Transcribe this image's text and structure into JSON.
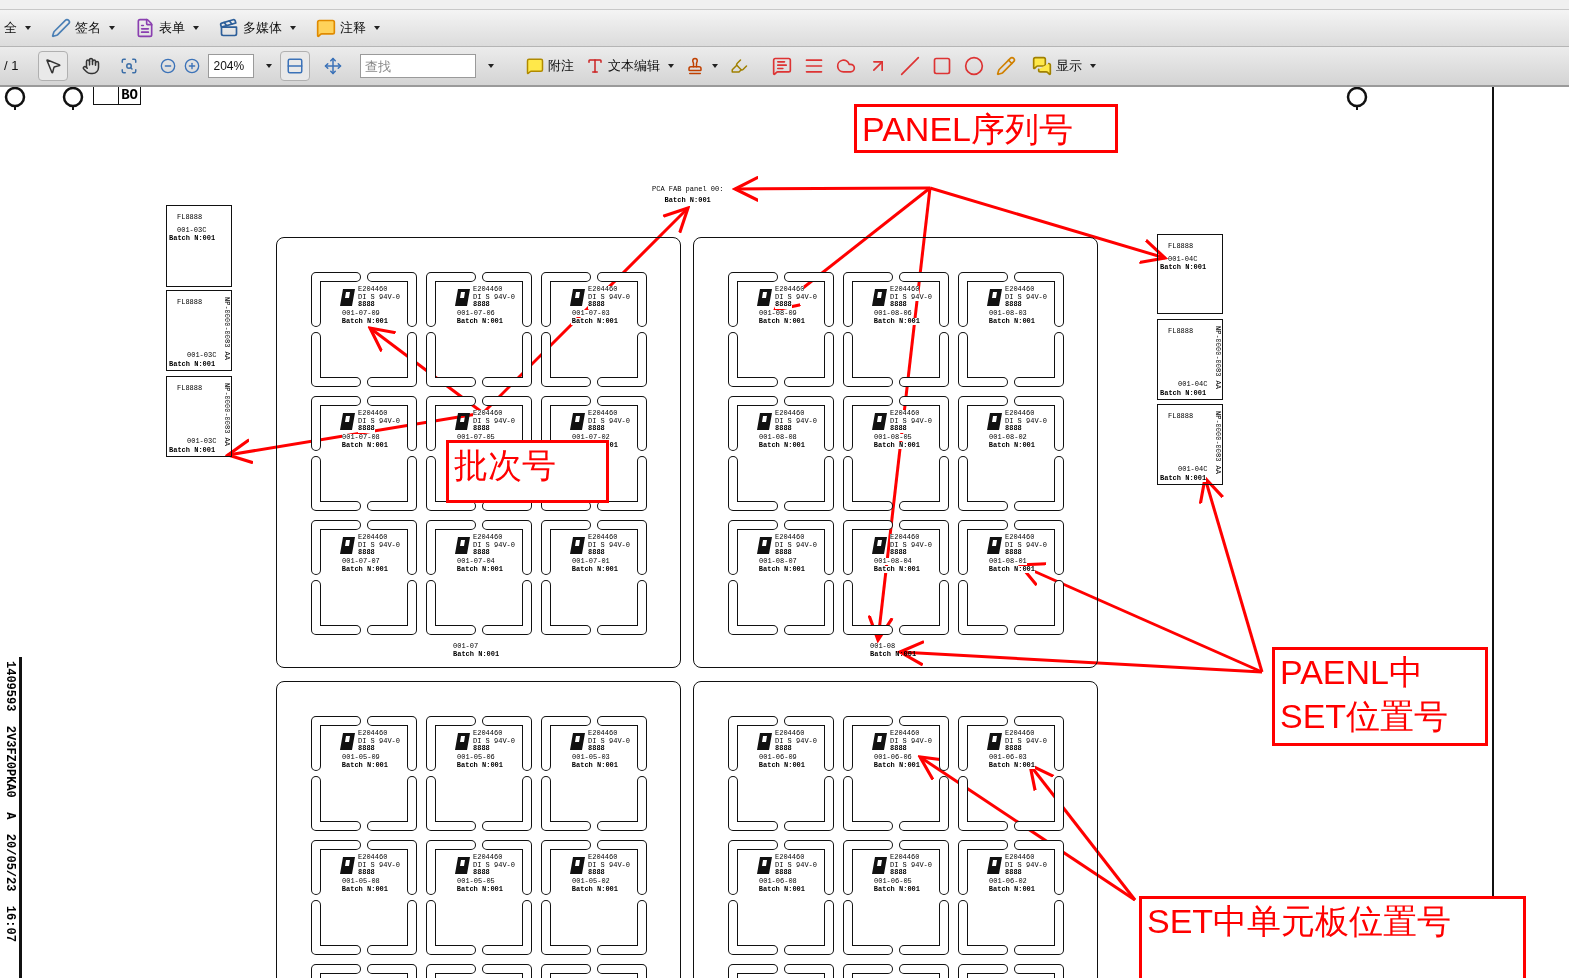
{
  "toolbar_top": {
    "items": [
      {
        "label": "全",
        "dropdown": true
      },
      {
        "label": "签名",
        "dropdown": true
      },
      {
        "label": "表单",
        "dropdown": true
      },
      {
        "label": "多媒体",
        "dropdown": true
      },
      {
        "label": "注释",
        "dropdown": true
      }
    ]
  },
  "toolbar_nav": {
    "page_count": "/ 1",
    "tools": [
      {
        "selected": true
      },
      {
        "selected": false
      },
      {
        "selected": false
      }
    ],
    "zoom_value": "204%",
    "view_modes": [
      {
        "selected": true
      },
      {
        "selected": false
      }
    ],
    "search": {
      "placeholder": "查找"
    },
    "comment_tools": [
      {
        "label": "附注",
        "dropdown": false
      },
      {
        "label": "文本编辑",
        "dropdown": true
      },
      {
        "dropdown": true
      },
      {
        "dropdown": false
      }
    ],
    "show": {
      "label": "显示",
      "dropdown": true
    }
  },
  "drawing": {
    "header_box": "BO",
    "side_stamp": "1409593  2V3FZ0PKA0  A  20/05/23  16:07",
    "panel_title": {
      "text": "PCA FAB panel 00:",
      "batch": "Batch N:001"
    },
    "left_coupons": [
      {
        "part": "FL8888",
        "code": "001-03C",
        "batch": "Batch N:001"
      },
      {
        "part": "FL8888",
        "vertical": "NP-0000-0083 AA",
        "code": "001-03C",
        "batch": "Batch N:001"
      },
      {
        "part": "FL8888",
        "vertical": "NP-0000-0083 AA",
        "code": "001-03C",
        "batch": "Batch N:001"
      }
    ],
    "right_coupons": [
      {
        "part": "FL8888",
        "code": "001-04C",
        "batch": "Batch N:001"
      },
      {
        "part": "FL8888",
        "vertical": "NP-0000-0083 AA",
        "code": "001-04C",
        "batch": "Batch N:001"
      },
      {
        "part": "FL8888",
        "vertical": "NP-0000-0083 AA",
        "code": "001-04C",
        "batch": "Batch N:001"
      }
    ],
    "panels": [
      {
        "label": "001-07",
        "batch": "Batch N:001",
        "cells": [
          {
            "ul": "E204460",
            "rating": "DI S 94V-0",
            "date": "8888",
            "code": "001-07-09",
            "batch": "Batch N:001"
          },
          {
            "ul": "E204460",
            "rating": "DI S 94V-0",
            "date": "8888",
            "code": "001-07-06",
            "batch": "Batch N:001"
          },
          {
            "ul": "E204460",
            "rating": "DI S 94V-0",
            "date": "8888",
            "code": "001-07-03",
            "batch": "Batch N:001"
          },
          {
            "ul": "E204460",
            "rating": "DI S 94V-0",
            "date": "8888",
            "code": "001-07-08",
            "batch": "Batch N:001"
          },
          {
            "ul": "E204460",
            "rating": "DI S 94V-0",
            "date": "8888",
            "code": "001-07-05"
          },
          {
            "ul": "E204460",
            "rating": "DI S 94V-0",
            "date": "8888",
            "code": "001-07-02",
            "batch": "01"
          },
          {
            "ul": "E204460",
            "rating": "DI S 94V-0",
            "date": "8888",
            "code": "001-07-07",
            "batch": "Batch N:001"
          },
          {
            "ul": "E204460",
            "rating": "DI S 94V-0",
            "date": "8888",
            "code": "001-07-04",
            "batch": "Batch N:001"
          },
          {
            "ul": "E204460",
            "rating": "DI S 94V-0",
            "date": "8888",
            "code": "001-07-01",
            "batch": "Batch N:001"
          }
        ]
      },
      {
        "label": "001-08",
        "batch": "Batch N:001",
        "cells": [
          {
            "ul": "E204460",
            "rating": "DI S 94V-0",
            "date": "8888",
            "code": "001-08-09",
            "batch": "Batch N:001"
          },
          {
            "ul": "E204460",
            "rating": "DI S 94V-0",
            "date": "8888",
            "code": "001-08-06",
            "batch": "Batch N:001"
          },
          {
            "ul": "E204460",
            "rating": "DI S 94V-0",
            "date": "8888",
            "code": "001-08-03",
            "batch": "Batch N:001"
          },
          {
            "ul": "E204460",
            "rating": "DI S 94V-0",
            "date": "8888",
            "code": "001-08-08",
            "batch": "Batch N:001"
          },
          {
            "ul": "E204460",
            "rating": "DI S 94V-0",
            "date": "8888",
            "code": "001-08-05",
            "batch": "Batch N:001"
          },
          {
            "ul": "E204460",
            "rating": "DI S 94V-0",
            "date": "8888",
            "code": "001-08-02",
            "batch": "Batch N:001"
          },
          {
            "ul": "E204460",
            "rating": "DI S 94V-0",
            "date": "8888",
            "code": "001-08-07",
            "batch": "Batch N:001"
          },
          {
            "ul": "E204460",
            "rating": "DI S 94V-0",
            "date": "8888",
            "code": "001-08-04",
            "batch": "Batch N:001"
          },
          {
            "ul": "E204460",
            "rating": "DI S 94V-0",
            "date": "8888",
            "code": "001-08-01",
            "batch": "Batch N:001"
          }
        ]
      },
      {
        "cells": [
          {
            "ul": "E204460",
            "rating": "DI S 94V-0",
            "date": "8888",
            "code": "001-05-09",
            "batch": "Batch N:001"
          },
          {
            "ul": "E204460",
            "rating": "DI S 94V-0",
            "date": "8888",
            "code": "001-05-06",
            "batch": "Batch N:001"
          },
          {
            "ul": "E204460",
            "rating": "DI S 94V-0",
            "date": "8888",
            "code": "001-05-03",
            "batch": "Batch N:001"
          },
          {
            "ul": "E204460",
            "rating": "DI S 94V-0",
            "date": "8888",
            "code": "001-05-08",
            "batch": "Batch N:001"
          },
          {
            "ul": "E204460",
            "rating": "DI S 94V-0",
            "date": "8888",
            "code": "001-05-05",
            "batch": "Batch N:001"
          },
          {
            "ul": "E204460",
            "rating": "DI S 94V-0",
            "date": "8888",
            "code": "001-05-02",
            "batch": "Batch N:001"
          }
        ]
      },
      {
        "cells": [
          {
            "ul": "E204460",
            "rating": "DI S 94V-0",
            "date": "8888",
            "code": "001-06-09",
            "batch": "Batch N:001"
          },
          {
            "ul": "E204460",
            "rating": "DI S 94V-0",
            "date": "8888",
            "code": "001-06-06",
            "batch": "Batch N:001"
          },
          {
            "ul": "E204460",
            "rating": "DI S 94V-0",
            "date": "8888",
            "code": "001-06-03",
            "batch": "Batch N:001"
          },
          {
            "ul": "E204460",
            "rating": "DI S 94V-0",
            "date": "8888",
            "code": "001-06-08",
            "batch": "Batch N:001"
          },
          {
            "ul": "E204460",
            "rating": "DI S 94V-0",
            "date": "8888",
            "code": "001-06-05",
            "batch": "Batch N:001"
          },
          {
            "ul": "E204460",
            "rating": "DI S 94V-0",
            "date": "8888",
            "code": "001-06-02",
            "batch": "Batch N:001"
          }
        ]
      }
    ]
  },
  "annotations": [
    {
      "lines": [
        "PANEL序列号"
      ]
    },
    {
      "lines": [
        "批次号"
      ]
    },
    {
      "lines": [
        "PAENL中",
        "SET位置号"
      ]
    },
    {
      "lines": [
        "SET中单元板位置号"
      ]
    }
  ]
}
